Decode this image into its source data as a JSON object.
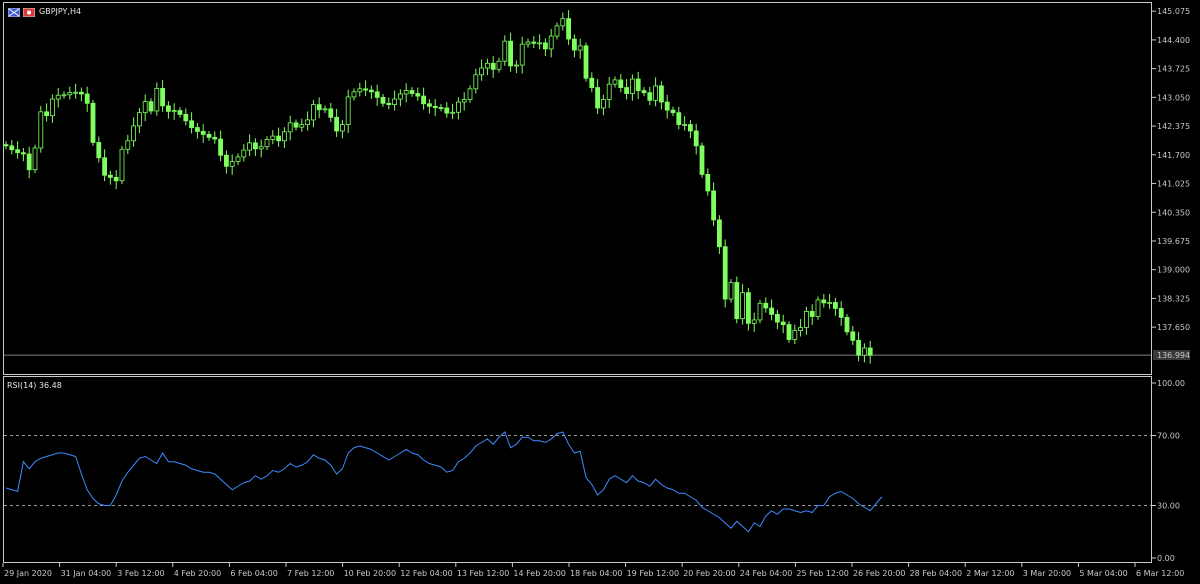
{
  "header": {
    "symbol_title": "GBPJPY,H4",
    "rsi_title": "RSI(14) 36.48",
    "flag_colors": [
      "#3b5bd8",
      "#d83b3b"
    ]
  },
  "colors": {
    "background": "#000000",
    "frame": "#c8c8c8",
    "candle_up": "#000000",
    "candle_down": "#7fff5f",
    "rsi_line": "#3d8bff",
    "price_line": "#7f7f7f"
  },
  "price_axis": {
    "labels": [
      "145.075",
      "144.400",
      "143.725",
      "143.050",
      "142.375",
      "141.700",
      "141.025",
      "140.350",
      "139.675",
      "139.000",
      "138.325",
      "137.650",
      "136.994"
    ],
    "current_price": 136.994,
    "range": [
      136.69,
      145.15
    ]
  },
  "rsi_axis": {
    "labels": [
      "100.00",
      "70.00",
      "30.00",
      "0.00"
    ],
    "levels": [
      70,
      30
    ],
    "range": [
      0,
      100
    ]
  },
  "time_axis": {
    "labels": [
      "29 Jan 2020",
      "31 Jan 04:00",
      "3 Feb 12:00",
      "4 Feb 20:00",
      "6 Feb 04:00",
      "7 Feb 12:00",
      "10 Feb 20:00",
      "12 Feb 04:00",
      "13 Feb 12:00",
      "14 Feb 20:00",
      "18 Feb 04:00",
      "19 Feb 12:00",
      "20 Feb 20:00",
      "24 Feb 04:00",
      "25 Feb 12:00",
      "26 Feb 20:00",
      "28 Feb 04:00",
      "2 Mar 12:00",
      "3 Mar 20:00",
      "5 Mar 04:00",
      "6 Mar 12:00"
    ]
  },
  "chart_data": [
    {
      "type": "candlestick",
      "title": "GBPJPY,H4",
      "ylim": [
        136.69,
        145.15
      ],
      "close": [
        141.91,
        141.82,
        141.75,
        141.72,
        141.35,
        141.86,
        142.71,
        142.62,
        143.01,
        143.1,
        143.11,
        143.16,
        143.17,
        143.13,
        142.91,
        141.99,
        141.63,
        141.22,
        141.17,
        141.09,
        141.83,
        142.03,
        142.38,
        142.69,
        142.95,
        142.73,
        143.26,
        142.85,
        142.72,
        142.74,
        142.65,
        142.5,
        142.34,
        142.25,
        142.18,
        142.11,
        142.07,
        141.69,
        141.43,
        141.54,
        141.65,
        141.81,
        141.98,
        141.84,
        141.89,
        142.06,
        142.14,
        142.03,
        142.24,
        142.45,
        142.35,
        142.41,
        142.52,
        142.88,
        142.76,
        142.78,
        142.58,
        142.26,
        142.41,
        143.06,
        143.18,
        143.25,
        143.22,
        143.18,
        143.05,
        142.91,
        142.88,
        143.01,
        143.13,
        143.21,
        143.14,
        143.08,
        142.9,
        142.84,
        142.81,
        142.8,
        142.68,
        142.7,
        142.94,
        143.0,
        143.25,
        143.58,
        143.74,
        143.85,
        143.71,
        143.9,
        144.37,
        143.79,
        143.81,
        144.3,
        144.35,
        144.32,
        144.33,
        144.19,
        144.49,
        144.73,
        144.9,
        144.42,
        144.16,
        144.26,
        143.5,
        143.28,
        142.8,
        143.0,
        143.36,
        143.46,
        143.28,
        143.14,
        143.48,
        143.21,
        143.16,
        142.98,
        143.32,
        142.94,
        142.75,
        142.69,
        142.41,
        142.41,
        142.26,
        141.91,
        141.24,
        140.85,
        140.17,
        139.54,
        138.31,
        138.7,
        137.85,
        138.46,
        137.74,
        137.82,
        138.21,
        138.1,
        137.95,
        137.77,
        137.71,
        137.36,
        137.57,
        137.64,
        138.02,
        137.9,
        138.29,
        138.22,
        138.23,
        138.09,
        137.88,
        137.54,
        137.34,
        136.99,
        137.16,
        136.99
      ],
      "open": [
        141.94,
        141.91,
        141.82,
        141.75,
        141.72,
        141.35,
        141.86,
        142.71,
        142.62,
        143.01,
        143.1,
        143.11,
        143.16,
        143.17,
        143.13,
        142.91,
        141.99,
        141.63,
        141.22,
        141.17,
        141.09,
        141.83,
        142.03,
        142.38,
        142.69,
        142.95,
        142.73,
        143.26,
        142.85,
        142.72,
        142.74,
        142.65,
        142.5,
        142.34,
        142.25,
        142.18,
        142.11,
        142.07,
        141.69,
        141.43,
        141.54,
        141.65,
        141.81,
        141.98,
        141.84,
        141.89,
        142.06,
        142.14,
        142.03,
        142.24,
        142.45,
        142.35,
        142.41,
        142.52,
        142.88,
        142.76,
        142.78,
        142.58,
        142.26,
        142.41,
        143.06,
        143.18,
        143.25,
        143.22,
        143.18,
        143.05,
        142.91,
        142.88,
        143.01,
        143.13,
        143.21,
        143.14,
        143.08,
        142.9,
        142.84,
        142.81,
        142.8,
        142.68,
        142.7,
        142.94,
        143.0,
        143.25,
        143.58,
        143.74,
        143.85,
        143.71,
        143.9,
        144.37,
        143.79,
        143.81,
        144.3,
        144.35,
        144.32,
        144.33,
        144.19,
        144.49,
        144.73,
        144.9,
        144.42,
        144.16,
        144.26,
        143.5,
        143.28,
        142.8,
        143.0,
        143.36,
        143.46,
        143.28,
        143.14,
        143.48,
        143.21,
        143.16,
        142.98,
        143.32,
        142.94,
        142.75,
        142.69,
        142.41,
        142.41,
        142.26,
        141.91,
        141.24,
        140.85,
        140.17,
        139.54,
        138.31,
        138.7,
        137.85,
        138.46,
        137.74,
        137.82,
        138.21,
        138.1,
        137.95,
        137.77,
        137.71,
        137.36,
        137.57,
        137.64,
        138.02,
        137.9,
        138.29,
        138.22,
        138.23,
        138.09,
        137.88,
        137.54,
        137.34,
        136.99,
        137.16
      ]
    },
    {
      "type": "line",
      "title": "RSI(14) 36.48",
      "ylim": [
        0,
        100
      ],
      "series": [
        {
          "values": [
            40,
            39,
            38,
            55,
            51,
            55,
            57,
            58,
            59,
            60,
            60,
            59,
            58,
            48,
            39,
            34,
            31,
            30,
            30,
            36,
            44,
            49,
            53,
            57,
            58,
            56,
            54,
            60,
            55,
            55,
            54,
            53,
            51,
            50,
            49,
            49,
            48,
            45,
            42,
            39,
            41,
            43,
            44,
            47,
            45,
            47,
            50,
            49,
            51,
            54,
            52,
            53,
            55,
            59,
            57,
            56,
            53,
            48,
            51,
            60,
            63,
            64,
            63,
            62,
            60,
            58,
            56,
            58,
            60,
            62,
            60,
            59,
            56,
            54,
            53,
            52,
            49,
            50,
            55,
            57,
            60,
            64,
            66,
            68,
            65,
            69,
            72,
            63,
            65,
            69,
            69,
            67,
            67,
            66,
            68,
            71,
            72,
            65,
            60,
            61,
            46,
            42,
            36,
            39,
            45,
            47,
            45,
            43,
            47,
            44,
            43,
            41,
            45,
            42,
            40,
            39,
            37,
            37,
            35,
            33,
            29,
            27,
            25,
            23,
            20,
            17,
            21,
            18,
            15,
            20,
            18,
            24,
            27,
            25,
            28,
            28,
            27,
            26,
            27,
            26,
            30,
            30,
            35,
            37,
            38,
            36,
            34,
            31,
            29,
            27,
            31,
            35
          ]
        }
      ]
    }
  ]
}
